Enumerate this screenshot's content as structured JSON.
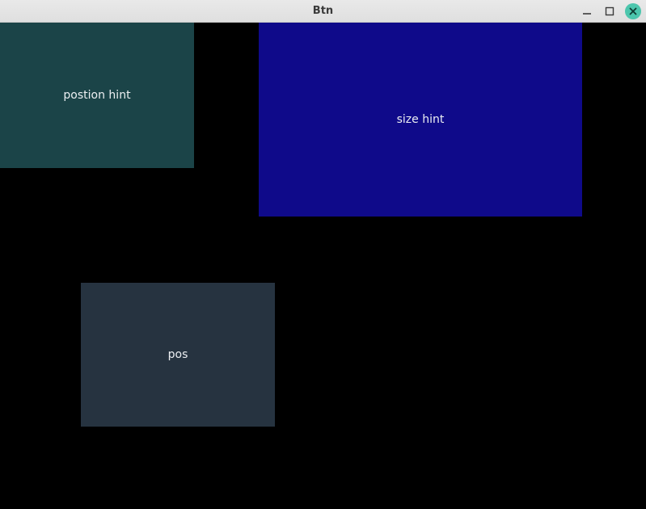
{
  "window": {
    "title": "Btn"
  },
  "buttons": {
    "position_hint": {
      "label": "postion hint"
    },
    "size_hint": {
      "label": "size hint"
    },
    "pos": {
      "label": "pos"
    }
  },
  "icons": {
    "minimize": "minimize-icon",
    "maximize": "maximize-icon",
    "close": "close-icon"
  }
}
